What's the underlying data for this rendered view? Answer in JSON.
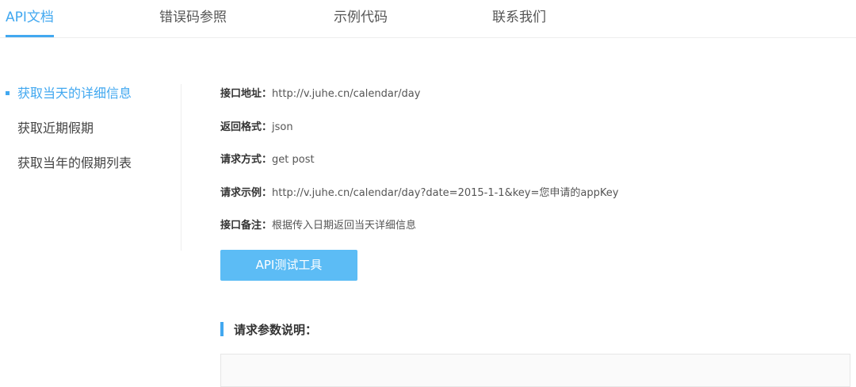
{
  "tabs": [
    {
      "label": "API文档",
      "active": true
    },
    {
      "label": "错误码参照",
      "active": false
    },
    {
      "label": "示例代码",
      "active": false
    },
    {
      "label": "联系我们",
      "active": false
    }
  ],
  "side_menu": [
    {
      "label": "获取当天的详细信息",
      "active": true
    },
    {
      "label": "获取近期假期",
      "active": false
    },
    {
      "label": "获取当年的假期列表",
      "active": false
    }
  ],
  "info": [
    {
      "label": "接口地址：",
      "value": "http://v.juhe.cn/calendar/day"
    },
    {
      "label": "返回格式：",
      "value": "json"
    },
    {
      "label": "请求方式：",
      "value": "get post"
    },
    {
      "label": "请求示例：",
      "value": "http://v.juhe.cn/calendar/day?date=2015-1-1&key=您申请的appKey"
    },
    {
      "label": "接口备注：",
      "value": "根据传入日期返回当天详细信息"
    }
  ],
  "test_button_label": "API测试工具",
  "section_title": "请求参数说明：",
  "colors": {
    "accent": "#42a8f0",
    "button": "#5cbcf5"
  }
}
